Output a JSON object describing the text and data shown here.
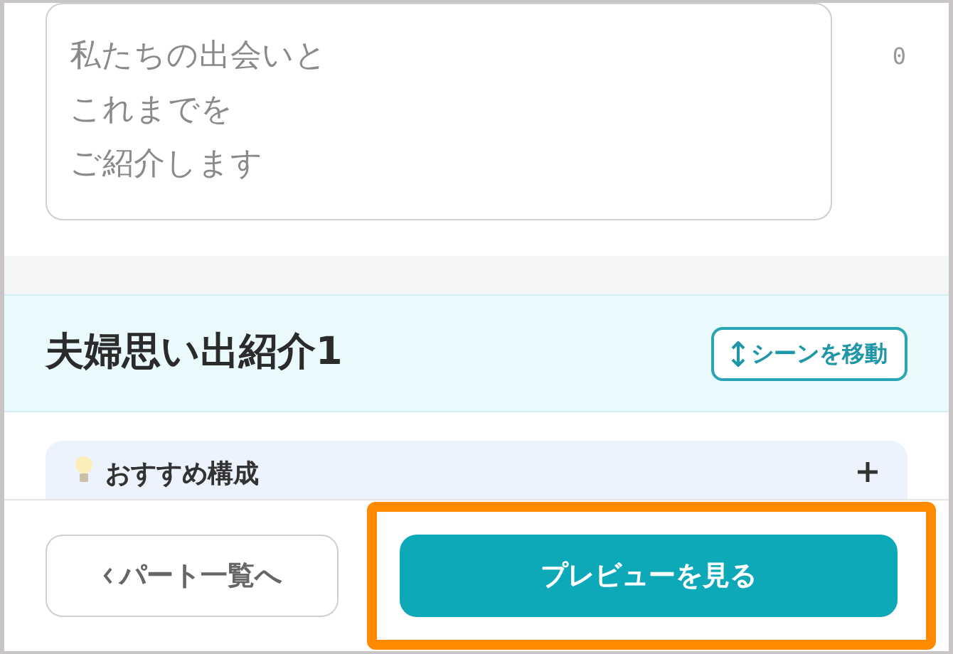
{
  "message_field": {
    "placeholder_lines": [
      "私たちの出会いと",
      "これまでを",
      "ご紹介します"
    ],
    "count": "0"
  },
  "scene": {
    "title": "夫婦思い出紹介1",
    "move_button": "シーンを移動"
  },
  "tip_card": {
    "title": "おすすめ構成"
  },
  "footer": {
    "back_button": "パート一覧へ",
    "preview_button": "プレビューを見る",
    "preview_highlighted": true
  }
}
